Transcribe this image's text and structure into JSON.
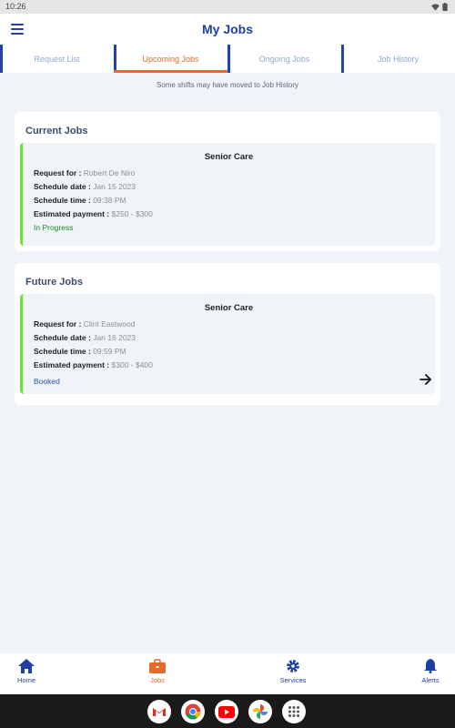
{
  "status_bar": {
    "time": "10:26"
  },
  "app_bar": {
    "title": "My Jobs",
    "menu_icon": "hamburger-menu-icon"
  },
  "tabs": [
    {
      "label": "Request List",
      "active": false
    },
    {
      "label": "Upcoming Jobs",
      "active": true
    },
    {
      "label": "Ongoing Jobs",
      "active": false
    },
    {
      "label": "Job History",
      "active": false
    }
  ],
  "notice": "Some shifts may have moved to Job History",
  "current_jobs": {
    "heading": "Current Jobs",
    "job": {
      "service": "Senior Care",
      "request_for_label": "Request for :",
      "request_for": "Robert De Niro",
      "schedule_date_label": "Schedule date :",
      "schedule_date": "Jan 15 2023",
      "schedule_time_label": "Schedule time :",
      "schedule_time": "09:38 PM",
      "payment_label": "Estimated payment :",
      "payment": "$250 - $300",
      "status": "In Progress"
    }
  },
  "future_jobs": {
    "heading": "Future Jobs",
    "job": {
      "service": "Senior Care",
      "request_for_label": "Request for :",
      "request_for": "Clint Eastwood",
      "schedule_date_label": "Schedule date :",
      "schedule_date": "Jan 16 2023",
      "schedule_time_label": "Schedule time :",
      "schedule_time": "09:59 PM",
      "payment_label": "Estimated payment :",
      "payment": "$300 - $400",
      "status": "Booked"
    }
  },
  "bottom_nav": {
    "home": "Home",
    "jobs": "Jobs",
    "services": "Services",
    "alerts": "Alerts"
  },
  "colors": {
    "primary": "#1f3fa3",
    "accent": "#e8672a",
    "in_progress": "#1e8a2a",
    "booked": "#2a58a8",
    "job_bar": "#6ee03a"
  },
  "dock_apps": [
    "gmail-icon",
    "chrome-icon",
    "youtube-icon",
    "photos-icon",
    "app-drawer-icon"
  ]
}
